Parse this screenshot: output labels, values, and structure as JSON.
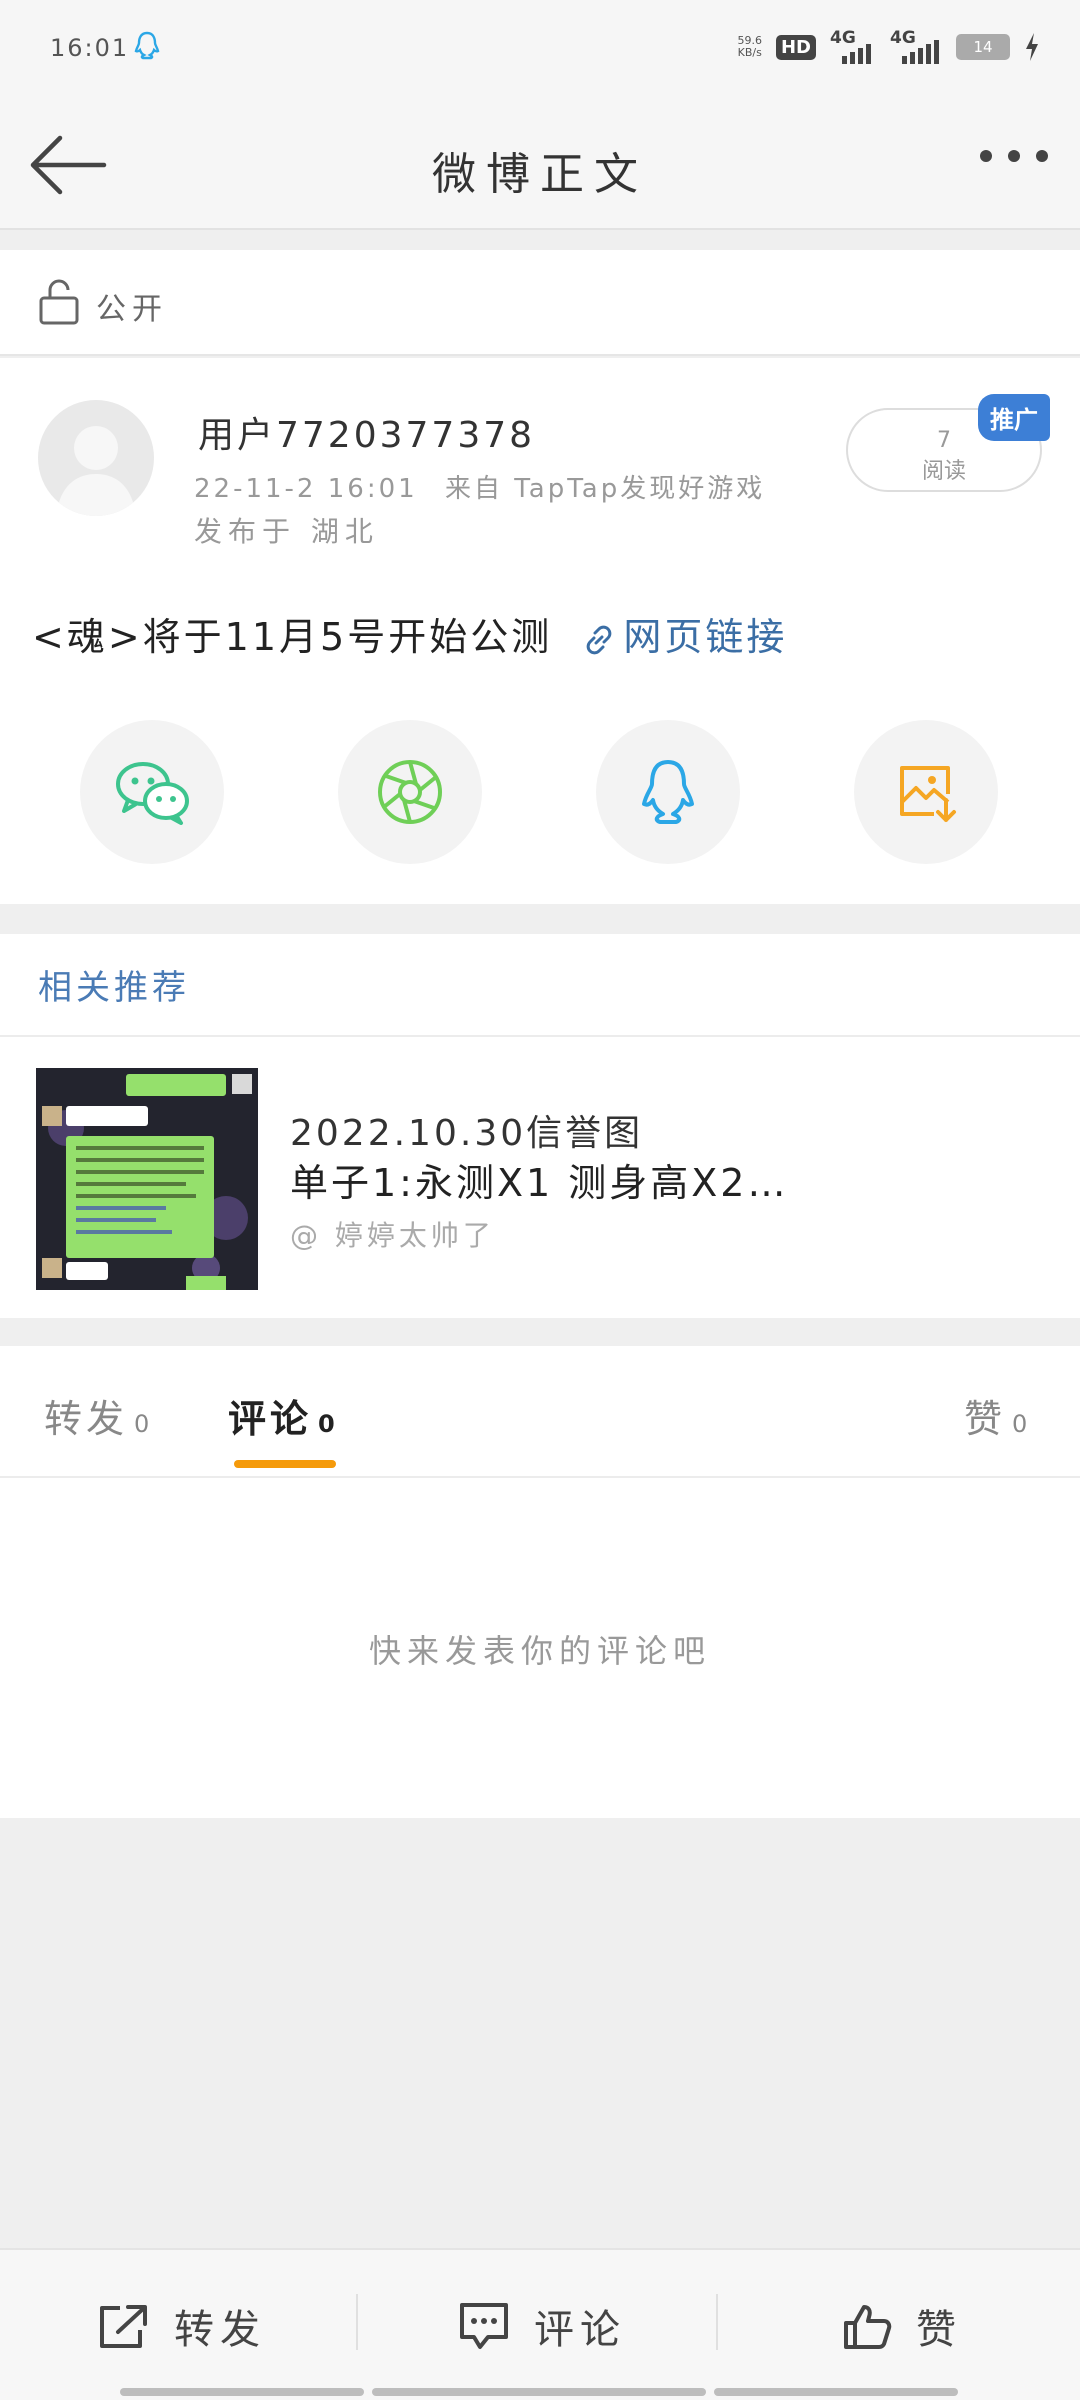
{
  "status_bar": {
    "time": "16:01",
    "net_speed_value": "59.6",
    "net_speed_unit": "KB/s",
    "hd_label": "HD",
    "sim1_label": "4G",
    "sim2_label": "4G",
    "battery": "14"
  },
  "nav": {
    "title": "微博正文"
  },
  "visibility": {
    "label": "公开"
  },
  "post": {
    "username": "用户7720377378",
    "time": "22-11-2 16:01",
    "source": "来自 TapTap发现好游戏",
    "location": "发布于 湖北",
    "read_count": "7",
    "read_label": "阅读",
    "promo_badge": "推广",
    "content": "<魂>将于11月5号开始公测",
    "link_text": "网页链接"
  },
  "share": {
    "icons": [
      "wechat-icon",
      "moments-icon",
      "qq-icon",
      "save-image-icon"
    ]
  },
  "related": {
    "title": "相关推荐",
    "item": {
      "title": "2022.10.30信誉图",
      "subtitle": "单子1:永测X1 测身高X2…",
      "author": "@ 婷婷太帅了"
    }
  },
  "tabs": {
    "repost": {
      "label": "转发",
      "count": "0"
    },
    "comment": {
      "label": "评论",
      "count": "0"
    },
    "like": {
      "label": "赞",
      "count": "0"
    }
  },
  "empty_state": "快来发表你的评论吧",
  "bottom_bar": {
    "repost": "转发",
    "comment": "评论",
    "like": "赞"
  },
  "colors": {
    "accent_orange": "#f59a0a",
    "link_blue": "#3b6ea5",
    "wechat_green": "#3dc48e",
    "moments_green": "#6fcf57",
    "qq_blue": "#2ba7e6",
    "save_orange": "#f5a623"
  }
}
